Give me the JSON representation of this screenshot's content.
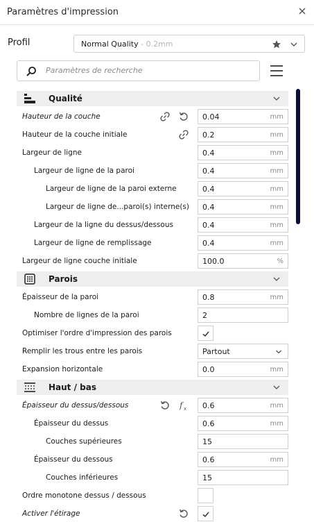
{
  "window": {
    "title": "Paramètres d'impression"
  },
  "profile": {
    "label": "Profil",
    "name": "Normal Quality",
    "suffix": " - 0.2mm"
  },
  "search": {
    "placeholder": "Paramètres de recherche"
  },
  "sections": {
    "quality": "Qualité",
    "walls": "Parois",
    "topbottom": "Haut / bas"
  },
  "settings": {
    "layer_height": {
      "label": "Hauteur de la couche",
      "value": "0.04",
      "unit": "mm"
    },
    "initial_layer_height": {
      "label": "Hauteur de la couche initiale",
      "value": "0.2",
      "unit": "mm"
    },
    "line_width": {
      "label": "Largeur de ligne",
      "value": "0.4",
      "unit": "mm"
    },
    "wall_line_width": {
      "label": "Largeur de ligne de la paroi",
      "value": "0.4",
      "unit": "mm"
    },
    "outer_wall_line_width": {
      "label": "Largeur de ligne de la paroi externe",
      "value": "0.4",
      "unit": "mm"
    },
    "inner_wall_line_width": {
      "label": "Largeur de ligne de...paroi(s) interne(s)",
      "value": "0.4",
      "unit": "mm"
    },
    "topbottom_line_width": {
      "label": "Largeur de la ligne du dessus/dessous",
      "value": "0.4",
      "unit": "mm"
    },
    "infill_line_width": {
      "label": "Largeur de ligne de remplissage",
      "value": "0.4",
      "unit": "mm"
    },
    "initial_layer_line_width": {
      "label": "Largeur de ligne couche initiale",
      "value": "100.0",
      "unit": "%"
    },
    "wall_thickness": {
      "label": "Épaisseur de la paroi",
      "value": "0.8",
      "unit": "mm"
    },
    "wall_line_count": {
      "label": "Nombre de lignes de la paroi",
      "value": "2"
    },
    "optimize_wall_order": {
      "label": "Optimiser l'ordre d'impression des parois",
      "checked": true
    },
    "fill_gaps": {
      "label": "Remplir les trous entre les parois",
      "value": "Partout"
    },
    "horizontal_expansion": {
      "label": "Expansion horizontale",
      "value": "0.0",
      "unit": "mm"
    },
    "topbottom_thickness": {
      "label": "Épaisseur du dessus/dessous",
      "value": "0.6",
      "unit": "mm"
    },
    "top_thickness": {
      "label": "Épaisseur du dessus",
      "value": "0.6",
      "unit": "mm"
    },
    "top_layers": {
      "label": "Couches supérieures",
      "value": "15"
    },
    "bottom_thickness": {
      "label": "Épaisseur du dessous",
      "value": "0.6",
      "unit": "mm"
    },
    "bottom_layers": {
      "label": "Couches inférieures",
      "value": "15"
    },
    "monotonic_topbottom": {
      "label": "Ordre monotone dessus / dessous",
      "checked": false
    },
    "enable_ironing": {
      "label": "Activer l'étirage",
      "checked": true
    }
  },
  "colors": {
    "scrollbar": "#0b0f3b",
    "section_bg": "#eeeeee",
    "border": "#cfcfcf"
  }
}
